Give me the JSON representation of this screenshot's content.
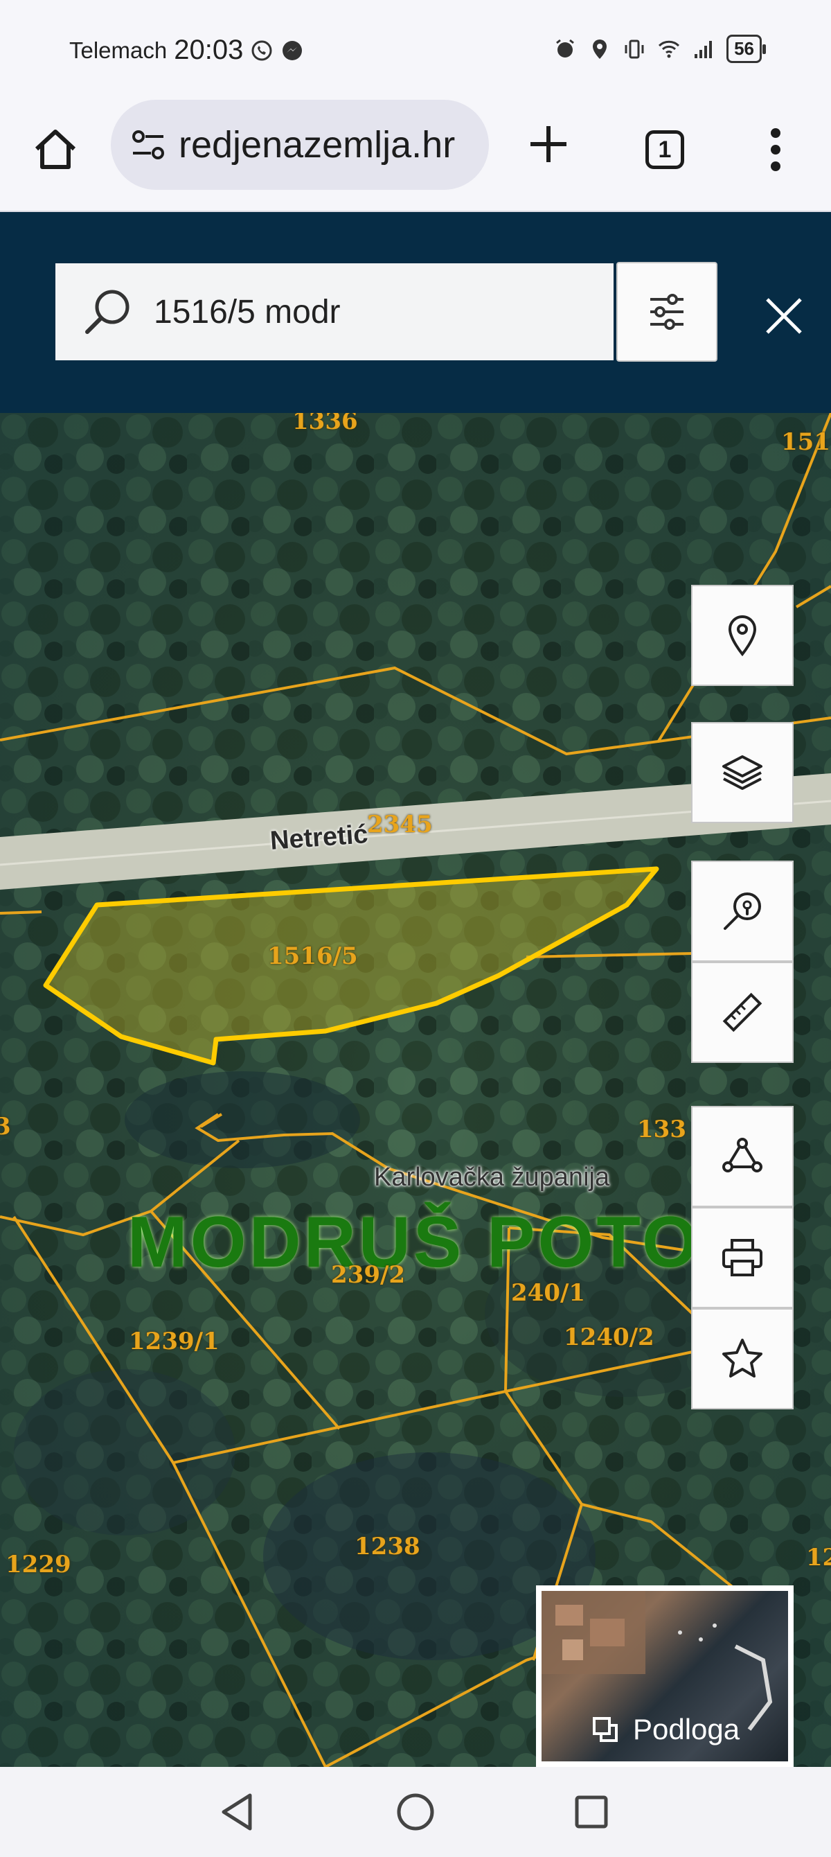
{
  "status_bar": {
    "carrier": "Telemach",
    "time": "20:03",
    "battery": "56"
  },
  "browser": {
    "url": "redjenazemlja.hr",
    "tab_count": "1"
  },
  "search": {
    "value": "1516/5 modr"
  },
  "map": {
    "parcel_labels": [
      "1336",
      "151",
      "2345",
      "1516/5",
      "133",
      "239/2",
      "240/1",
      "1240/2",
      "1239/1",
      "1238",
      "1229",
      "12",
      "3"
    ],
    "selected_parcel": "1516/5",
    "road_label": "Netretić",
    "county_label": "Karlovačka županija",
    "area_label": "MODRUŠ POTOK",
    "colors": {
      "parcel_line": "#e8a41c",
      "selected_outline": "#ffcc00",
      "header_bg": "#062c45"
    }
  },
  "tools": {
    "location_icon": "map-pin-icon",
    "layers_icon": "layers-icon",
    "search_location_icon": "search-location-icon",
    "measure_icon": "ruler-icon",
    "draw_icon": "polygon-icon",
    "print_icon": "printer-icon",
    "favorite_icon": "star-icon"
  },
  "basemap": {
    "label": "Podloga"
  }
}
